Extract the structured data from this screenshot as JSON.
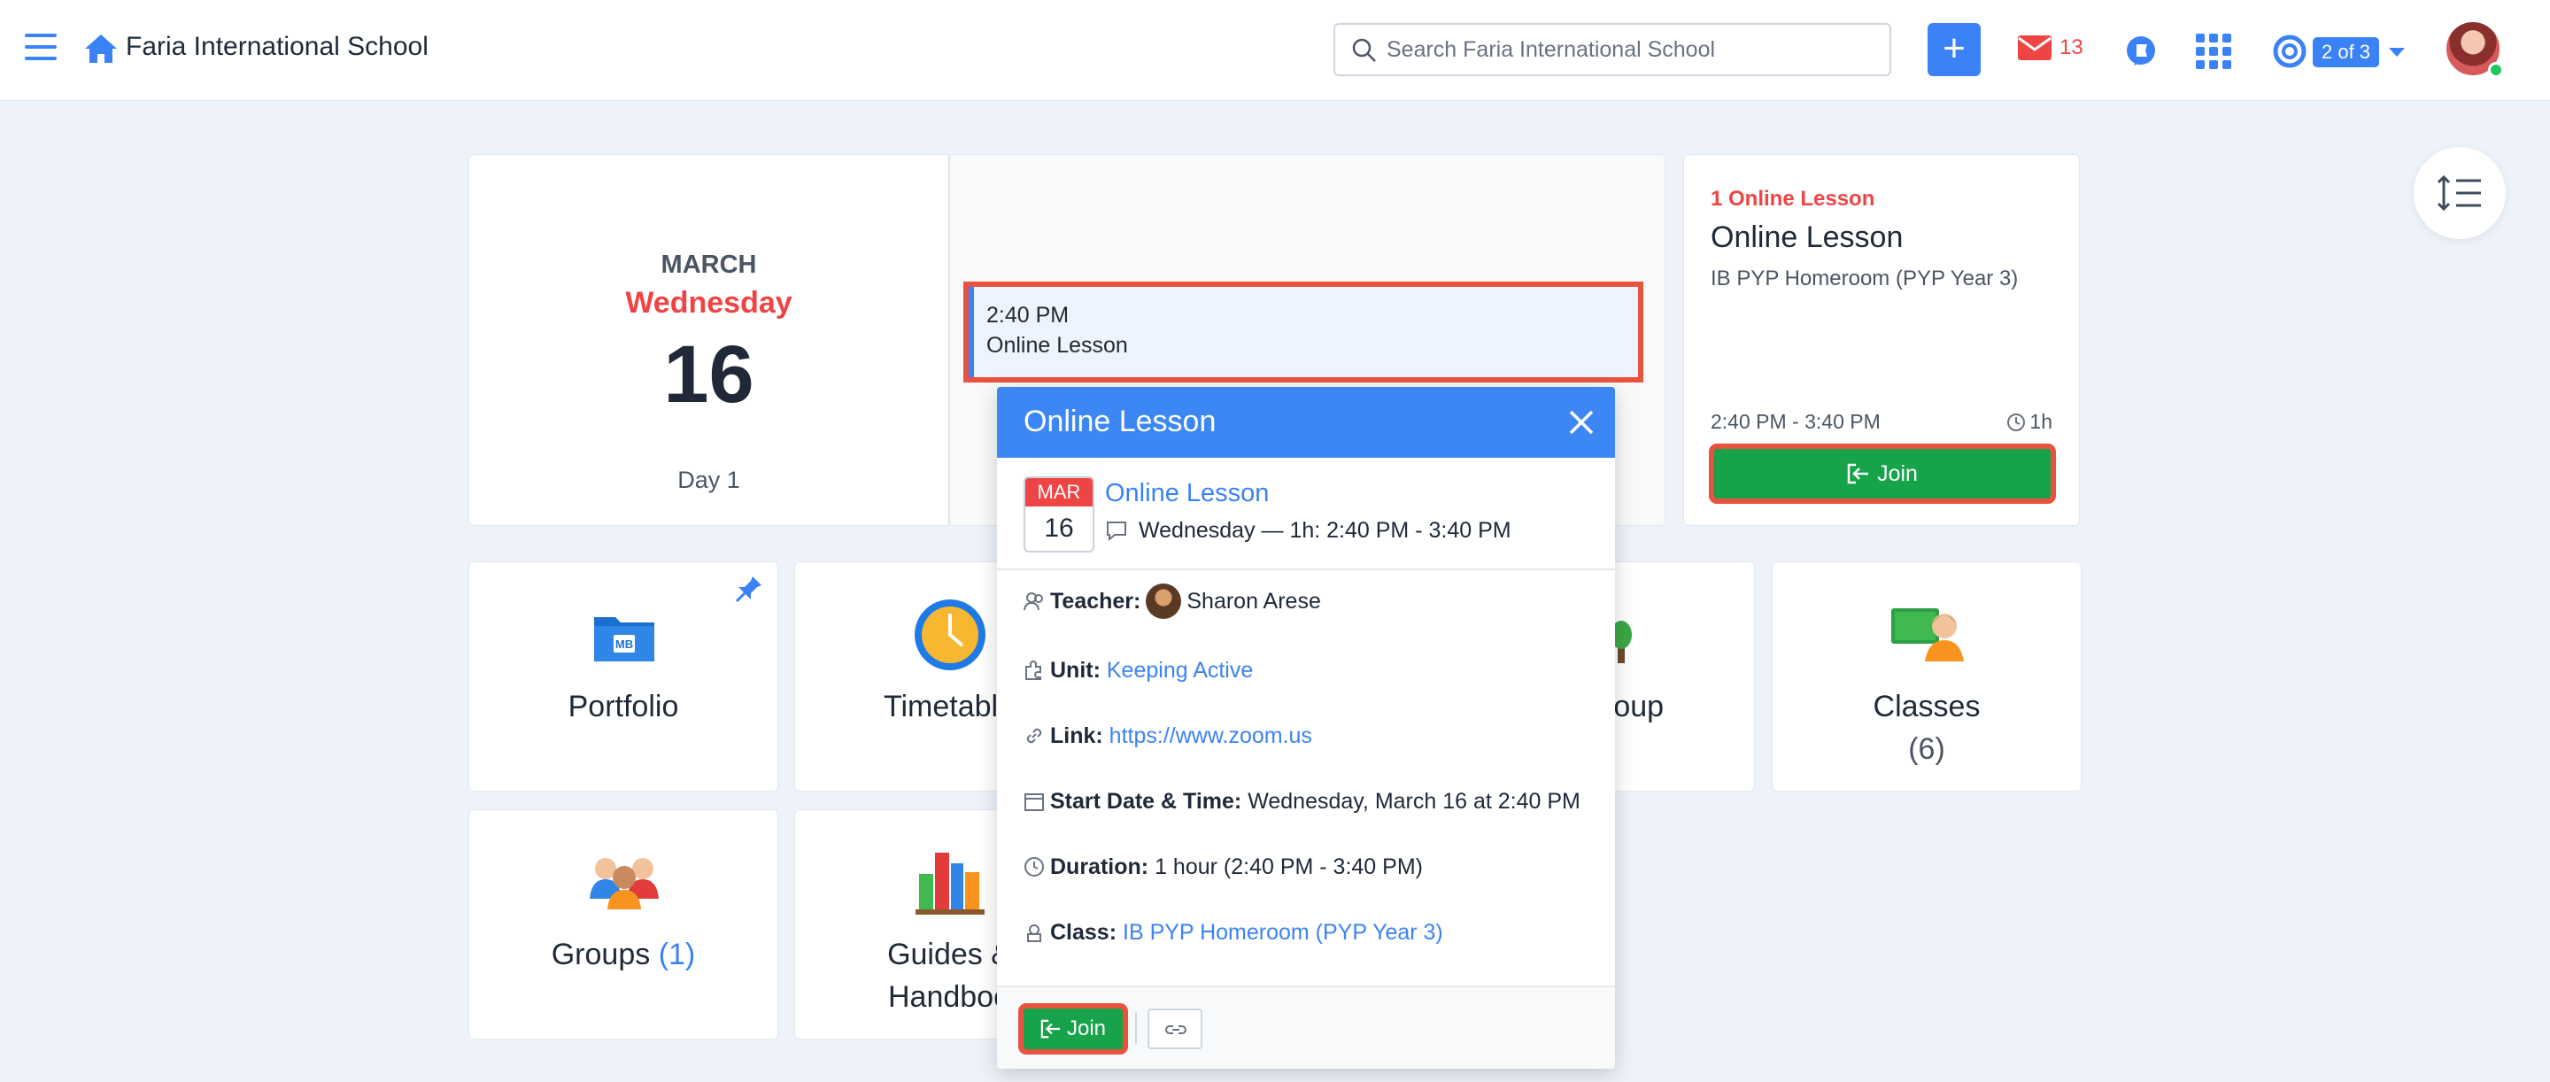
{
  "header": {
    "brand": "Faria International School",
    "search_placeholder": "Search Faria International School",
    "mail_count": "13",
    "help_pill": "2 of 3"
  },
  "date_card": {
    "month": "MARCH",
    "weekday": "Wednesday",
    "day": "16",
    "day_label": "Day 1"
  },
  "event_chip": {
    "time": "2:40 PM",
    "title": "Online Lesson"
  },
  "lesson_card": {
    "count": "1 Online Lesson",
    "title": "Online Lesson",
    "class": "IB PYP Homeroom (PYP Year 3)",
    "time": "2:40 PM - 3:40 PM",
    "duration": "1h",
    "join_label": "Join"
  },
  "tiles": {
    "portfolio": "Portfolio",
    "timetable": "Timetable",
    "group_partial": "roup",
    "classes": "Classes",
    "classes_count": "(6)",
    "groups": "Groups",
    "groups_count": "(1)",
    "guides_line1": "Guides &",
    "guides_line2": "Handboo"
  },
  "popup": {
    "title": "Online Lesson",
    "cal_month": "MAR",
    "cal_day": "16",
    "lesson_title": "Online Lesson",
    "when": "Wednesday — 1h: 2:40 PM - 3:40 PM",
    "teacher_label": "Teacher:",
    "teacher": "Sharon Arese",
    "unit_label": "Unit:",
    "unit": "Keeping Active",
    "link_label": "Link:",
    "link": "https://www.zoom.us",
    "start_label": "Start Date & Time:",
    "start": "Wednesday, March 16 at 2:40 PM",
    "duration_label": "Duration:",
    "duration": "1 hour (2:40 PM - 3:40 PM)",
    "class_label": "Class:",
    "class": "IB PYP Homeroom (PYP Year 3)",
    "join_label": "Join"
  },
  "colors": {
    "accent": "#3b82f6",
    "danger": "#ef4444",
    "success": "#16a34a",
    "highlight": "#e8533f"
  }
}
